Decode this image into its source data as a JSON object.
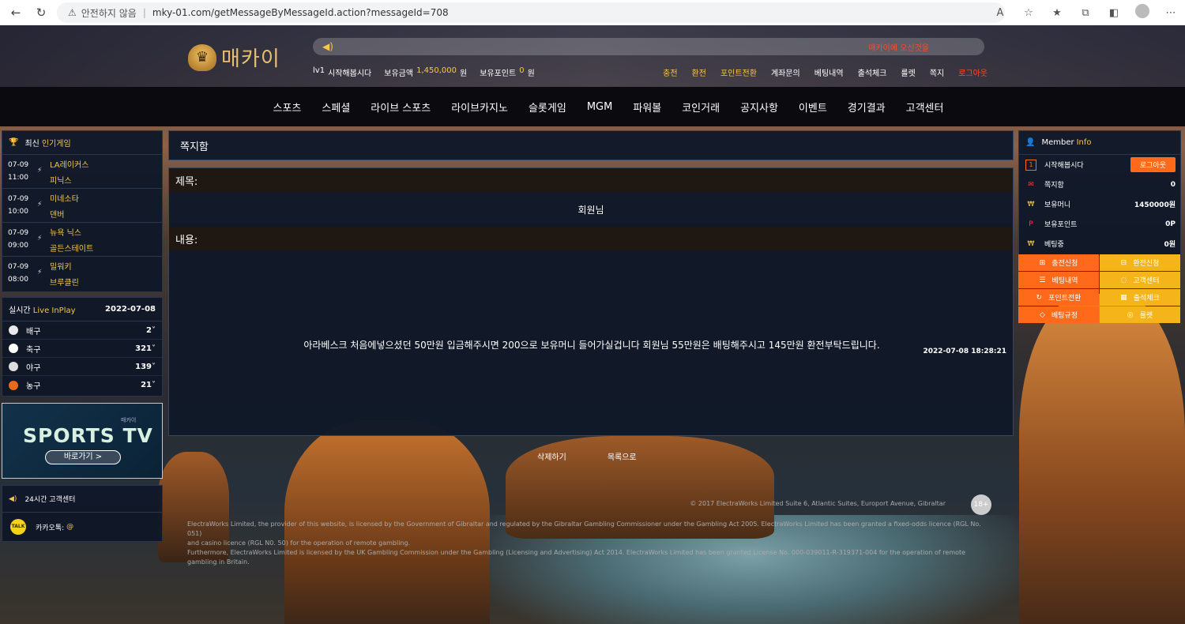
{
  "browser": {
    "security": "안전하지 않음",
    "url": "mky-01.com/getMessageByMessageId.action?messageId=708"
  },
  "header": {
    "logo_text": "매카이",
    "ticker_message": "매카이에 오신것을",
    "user_level": "lv1",
    "username": "시작해봅시다",
    "balance_label": "보유금액",
    "balance_value": "1,450,000",
    "balance_unit": "원",
    "points_label": "보유포인트",
    "points_value": "0",
    "points_unit": "원",
    "links": [
      "충전",
      "환전",
      "포인트전환",
      "계좌문의",
      "베팅내역",
      "출석체크",
      "룰렛",
      "쪽지",
      "로그아웃"
    ]
  },
  "nav": [
    "스포츠",
    "스페셜",
    "라이브 스포츠",
    "라이브카지노",
    "슬롯게임",
    "MGM",
    "파워볼",
    "코인거래",
    "공지사항",
    "이벤트",
    "경기결과",
    "고객센터"
  ],
  "popular": {
    "title_a": "최신",
    "title_b": "인기게임",
    "games": [
      {
        "date": "07-09",
        "time": "11:00",
        "team1": "LA레이커스",
        "team2": "피닉스"
      },
      {
        "date": "07-09",
        "time": "10:00",
        "team1": "미네소타",
        "team2": "덴버"
      },
      {
        "date": "07-09",
        "time": "09:00",
        "team1": "뉴욕 닉스",
        "team2": "골든스테이트"
      },
      {
        "date": "07-09",
        "time": "08:00",
        "team1": "밀워키",
        "team2": "브루클린"
      }
    ]
  },
  "live": {
    "title_a": "실시간",
    "title_b": "Live InPlay",
    "date": "2022-07-08",
    "rows": [
      {
        "name": "배구",
        "count": "2",
        "color": "#e8e8ee"
      },
      {
        "name": "축구",
        "count": "321",
        "color": "#ffffff"
      },
      {
        "name": "야구",
        "count": "139",
        "color": "#dddddd"
      },
      {
        "name": "농구",
        "count": "21",
        "color": "#e86a1a"
      }
    ]
  },
  "sportstv": {
    "brand": "매카이",
    "title": "SPORTS TV",
    "button": "바로가기 >"
  },
  "support": {
    "title": "24시간 고객센터",
    "kakao_label": "카카오톡:",
    "kakao_value": "@",
    "kakao_icon": "TALK"
  },
  "message": {
    "page_title": "쪽지함",
    "subject_label": "제목:",
    "subject": "회원님",
    "content_label": "내용:",
    "content": "아라베스크 처음에넣으셨던 50만원 입금해주시면 200으로 보유머니 들어가실겁니다 회원님 55만원은 배팅해주시고 145만원 환전부탁드립니다.",
    "date": "2022-07-08 18:28:21",
    "delete_button": "삭제하기",
    "list_button": "목록으로"
  },
  "footer": {
    "copyright": "© 2017 ElectraWorks Limited Suite 6, Atlantic Suites, Europort Avenue, Gibraltar",
    "age": "18+",
    "line1": "ElectraWorks Limited, the provider of this website, is licensed by the Government of Gibraltar and regulated by the Gibraltar Gambling Commissioner under the Gambling Act 2005. ElectraWorks Limited has been granted a fixed-odds licence (RGL No. 051)",
    "line2": "and casino licence (RGL N0. 50) for the operation of remote gambling.",
    "line3": "Furthermore, ElectraWorks Limited is licensed by the UK Gambling Commission under the Gambling (Licensing and Advertising) Act 2014. ElectraWorks Limited has been granted License No. 000-039011-R-319371-004 for the operation of remote gambling in Britain."
  },
  "member": {
    "title_a": "Member",
    "title_b": "Info",
    "username": "시작해봅시다",
    "level_badge": "1",
    "logout": "로그아웃",
    "rows": [
      {
        "label": "쪽지함",
        "value": "0"
      },
      {
        "label": "보유머니",
        "value": "1450000원"
      },
      {
        "label": "보유포인트",
        "value": "0P"
      },
      {
        "label": "베팅중",
        "value": "0원"
      }
    ],
    "quick": [
      "충전신청",
      "환전신청",
      "베팅내역",
      "고객센터",
      "포인트전환",
      "출석체크",
      "베팅규정",
      "룰렛"
    ]
  },
  "colors": {
    "accent_yellow": "#f5c84a",
    "accent_orange": "#ff6a1a",
    "alert_red": "#ff4a2a",
    "panel": "#101828"
  }
}
